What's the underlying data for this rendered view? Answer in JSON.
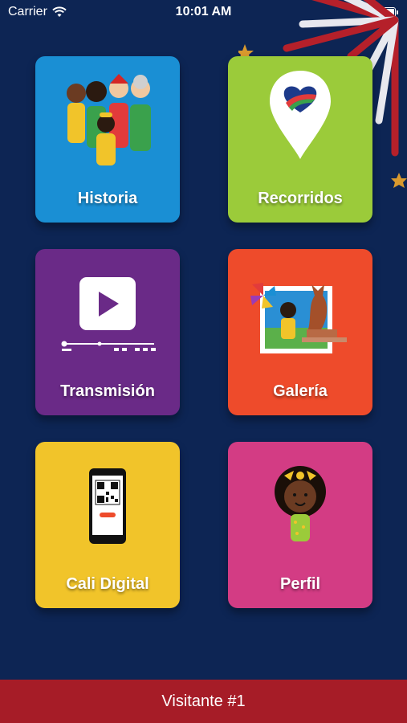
{
  "status": {
    "carrier": "Carrier",
    "time": "10:01 AM",
    "battery_level": 1.0
  },
  "tiles": [
    {
      "label": "Historia",
      "color": "#1a8fd4"
    },
    {
      "label": "Recorridos",
      "color": "#9bcb3a"
    },
    {
      "label": "Transmisión",
      "color": "#6a2a87"
    },
    {
      "label": "Galería",
      "color": "#ee4b2b"
    },
    {
      "label": "Cali Digital",
      "color": "#f1c42a"
    },
    {
      "label": "Perfil",
      "color": "#d33c84"
    }
  ],
  "footer": {
    "label": "Visitante #1",
    "color": "#a61c27"
  },
  "icons": [
    "wifi-icon",
    "battery-icon",
    "play-icon",
    "location-pin-icon",
    "phone-qr-icon"
  ]
}
